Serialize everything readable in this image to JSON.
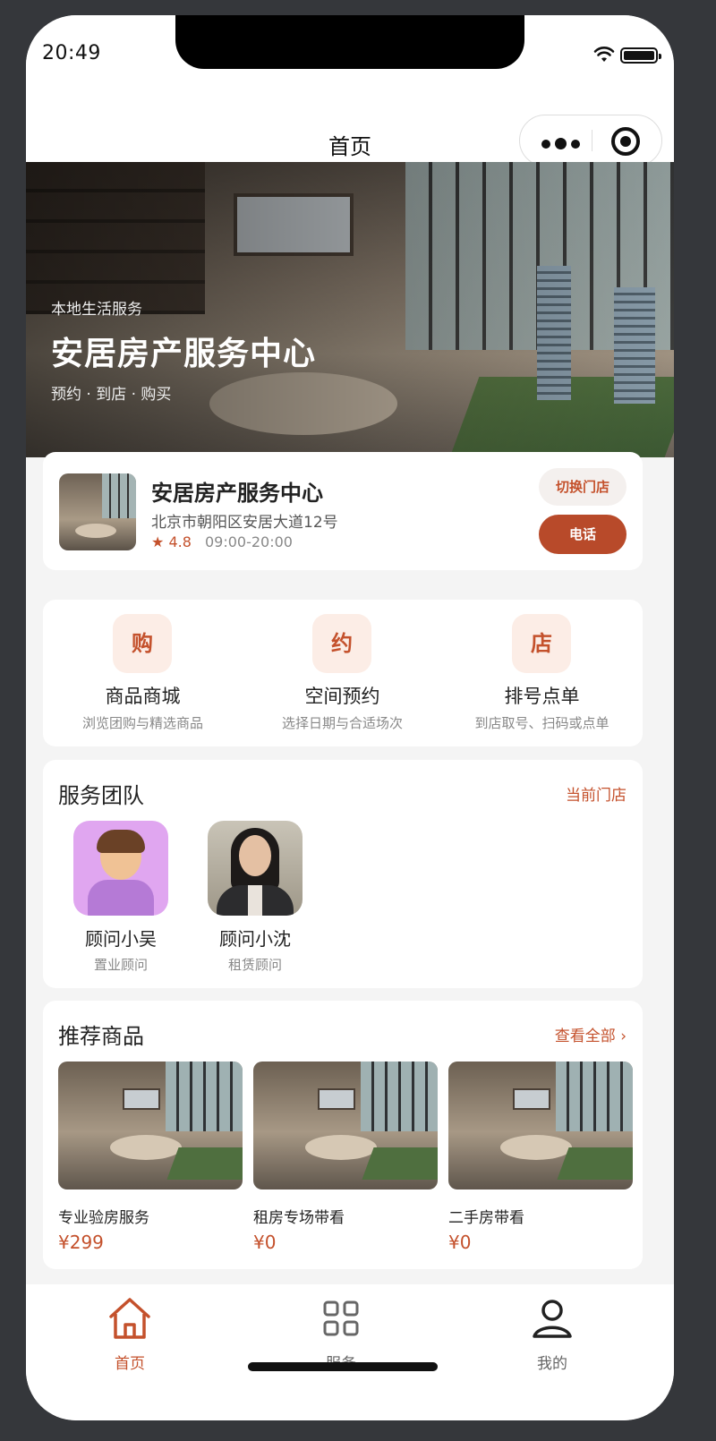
{
  "status_bar": {
    "time": "20:49"
  },
  "nav": {
    "title": "首页"
  },
  "hero": {
    "kicker": "本地生活服务",
    "title": "安居房产服务中心",
    "subtitle": "预约 · 到店 · 购买"
  },
  "store": {
    "name": "安居房产服务中心",
    "address": "北京市朝阳区安居大道12号",
    "rating": "4.8",
    "hours": "09:00-20:00",
    "switch_label": "切换门店",
    "call_label": "电话"
  },
  "quick_actions": [
    {
      "icon_char": "购",
      "label": "商品商城",
      "desc": "浏览团购与精选商品"
    },
    {
      "icon_char": "约",
      "label": "空间预约",
      "desc": "选择日期与合适场次"
    },
    {
      "icon_char": "店",
      "label": "排号点单",
      "desc": "到店取号、扫码或点单"
    }
  ],
  "team": {
    "title": "服务团队",
    "link": "当前门店",
    "members": [
      {
        "name": "顾问小吴",
        "role": "置业顾问",
        "avatar": "cartoon-avatar"
      },
      {
        "name": "顾问小沈",
        "role": "租赁顾问",
        "avatar": "photo-avatar"
      }
    ]
  },
  "recommend": {
    "title": "推荐商品",
    "link": "查看全部 ›",
    "products": [
      {
        "name": "专业验房服务",
        "price": "¥299"
      },
      {
        "name": "租房专场带看",
        "price": "¥0"
      },
      {
        "name": "二手房带看",
        "price": "¥0"
      }
    ]
  },
  "tabbar": {
    "tabs": [
      {
        "label": "首页",
        "icon": "home-icon",
        "active": true
      },
      {
        "label": "服务",
        "icon": "grid-icon",
        "active": false
      },
      {
        "label": "我的",
        "icon": "user-icon",
        "active": false
      }
    ]
  },
  "colors": {
    "accent": "#c4512c",
    "accent_dark": "#b84a2a",
    "accent_bg": "#fcede6"
  }
}
